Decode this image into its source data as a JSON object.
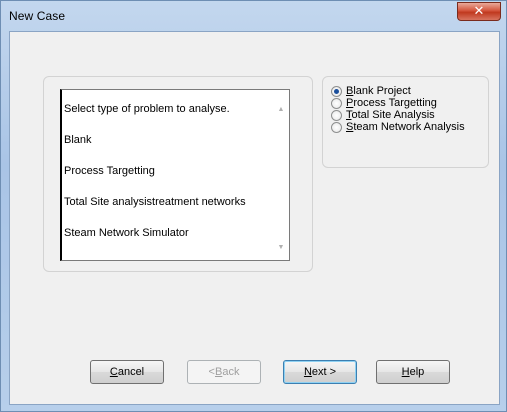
{
  "window": {
    "title": "New Case"
  },
  "listbox": {
    "items": [
      "Select type of problem to analyse.",
      "Blank",
      "Process Targetting",
      "Total Site analysistreatment networks",
      "Steam Network Simulator"
    ]
  },
  "options": {
    "selected": "Blank Project",
    "items": [
      {
        "pre": "",
        "ul": "B",
        "post": "lank Project",
        "checked": true
      },
      {
        "pre": "",
        "ul": "P",
        "post": "rocess Targetting",
        "checked": false
      },
      {
        "pre": "",
        "ul": "T",
        "post": "otal Site Analysis",
        "checked": false
      },
      {
        "pre": "",
        "ul": "S",
        "post": "team Network Analysis",
        "checked": false
      }
    ]
  },
  "buttons": {
    "cancel": {
      "ul": "C",
      "post": "ancel"
    },
    "back": {
      "pre": "<",
      "ul": "B",
      "post": "ack"
    },
    "next": {
      "ul": "N",
      "post": "ext >"
    },
    "help": {
      "ul": "H",
      "post": "elp"
    }
  },
  "colors": {
    "close_button": "#c7432a",
    "radio_dot": "#1b4f9c"
  }
}
